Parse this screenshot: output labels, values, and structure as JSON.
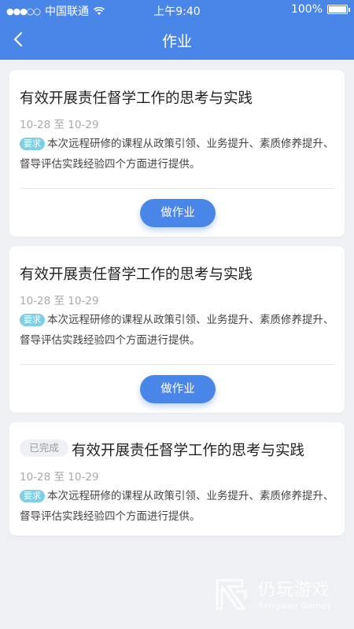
{
  "status_bar": {
    "carrier_signal": "●●●○○",
    "carrier": "中国联通",
    "time": "上午9:40",
    "battery": "100%"
  },
  "nav": {
    "title": "作业"
  },
  "cards": [
    {
      "title": "有效开展责任督学工作的思考与实践",
      "date": "10-28 至 10-29",
      "tag": "要求",
      "description": "本次远程研修的课程从政策引领、业务提升、素质修养提升、督导评估实践经验四个方面进行提供。",
      "button": "做作业"
    },
    {
      "title": "有效开展责任督学工作的思考与实践",
      "date": "10-28 至 10-29",
      "tag": "要求",
      "description": "本次远程研修的课程从政策引领、业务提升、素质修养提升、督导评估实践经验四个方面进行提供。",
      "button": "做作业"
    },
    {
      "status": "已完成",
      "title": "有效开展责任督学工作的思考与实践",
      "date": "10-28 至 10-29",
      "tag": "要求",
      "description": "本次远程研修的课程从政策引领、业务提升、素质修养提升、督导评估实践经验四个方面进行提供。"
    }
  ],
  "watermark": {
    "name": "仍玩游戏",
    "sub": "Rengwan Games"
  },
  "colors": {
    "primary": "#4a86e8",
    "tag": "#7ecfe3",
    "background": "#eef0f3"
  }
}
